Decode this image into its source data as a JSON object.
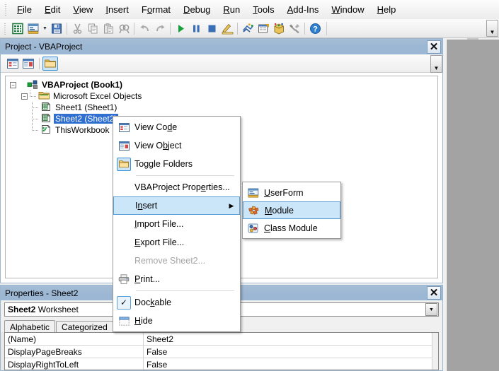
{
  "menubar": {
    "items": [
      {
        "label": "File",
        "accel": "F"
      },
      {
        "label": "Edit",
        "accel": "E"
      },
      {
        "label": "View",
        "accel": "V"
      },
      {
        "label": "Insert",
        "accel": "I"
      },
      {
        "label": "Format",
        "accel": "o"
      },
      {
        "label": "Debug",
        "accel": "D"
      },
      {
        "label": "Run",
        "accel": "R"
      },
      {
        "label": "Tools",
        "accel": "T"
      },
      {
        "label": "Add-Ins",
        "accel": "A"
      },
      {
        "label": "Window",
        "accel": "W"
      },
      {
        "label": "Help",
        "accel": "H"
      }
    ]
  },
  "toolbar": {
    "buttons": [
      {
        "name": "view-excel-icon",
        "title": "View Microsoft Excel"
      },
      {
        "name": "insert-userform-icon",
        "title": "Insert UserForm"
      },
      {
        "name": "save-icon",
        "title": "Save Book1"
      },
      {
        "name": "cut-icon",
        "title": "Cut"
      },
      {
        "name": "copy-icon",
        "title": "Copy"
      },
      {
        "name": "paste-icon",
        "title": "Paste"
      },
      {
        "name": "find-icon",
        "title": "Find"
      },
      {
        "name": "undo-icon",
        "title": "Undo"
      },
      {
        "name": "redo-icon",
        "title": "Redo"
      },
      {
        "name": "run-icon",
        "title": "Run Sub/UserForm"
      },
      {
        "name": "pause-icon",
        "title": "Break"
      },
      {
        "name": "stop-icon",
        "title": "Reset"
      },
      {
        "name": "design-mode-icon",
        "title": "Design Mode"
      },
      {
        "name": "project-explorer-icon",
        "title": "Project Explorer"
      },
      {
        "name": "properties-window-icon",
        "title": "Properties Window"
      },
      {
        "name": "object-browser-icon",
        "title": "Object Browser"
      },
      {
        "name": "toolbox-icon",
        "title": "Toolbox"
      },
      {
        "name": "help-icon",
        "title": "Microsoft Visual Basic for Applications Help"
      }
    ]
  },
  "project_panel": {
    "title": "Project - VBAProject",
    "close_label": "✕",
    "toolbar": [
      {
        "name": "view-code-icon",
        "title": "View Code"
      },
      {
        "name": "view-object-icon",
        "title": "View Object"
      },
      {
        "name": "toggle-folders-icon",
        "title": "Toggle Folders",
        "selected": true
      }
    ],
    "tree": [
      {
        "label": "VBAProject (Book1)",
        "level": 0,
        "bold": true,
        "selected": false,
        "icon": "vbaproject-icon",
        "expander": "-"
      },
      {
        "label": "Microsoft Excel Objects",
        "level": 1,
        "bold": false,
        "selected": false,
        "icon": "folder-icon",
        "expander": "-"
      },
      {
        "label": "Sheet1 (Sheet1)",
        "level": 2,
        "bold": false,
        "selected": false,
        "icon": "worksheet-icon",
        "expander": ""
      },
      {
        "label": "Sheet2 (Sheet2)",
        "level": 2,
        "bold": false,
        "selected": true,
        "icon": "worksheet-icon",
        "expander": ""
      },
      {
        "label": "ThisWorkbook",
        "level": 2,
        "bold": false,
        "selected": false,
        "icon": "workbook-icon",
        "expander": ""
      }
    ]
  },
  "context_menu": {
    "items": [
      {
        "label": "View Code",
        "accel": "d",
        "icon": "view-code-icon",
        "state": "normal",
        "submenu": false
      },
      {
        "label": "View Object",
        "accel": "b",
        "icon": "view-object-icon",
        "state": "normal",
        "submenu": false
      },
      {
        "label": "Toggle Folders",
        "accel": "",
        "icon": "toggle-folders-icon",
        "state": "normal",
        "submenu": false
      },
      {
        "separator": true
      },
      {
        "label": "VBAProject Properties...",
        "accel": "e",
        "icon": "",
        "state": "normal",
        "submenu": false
      },
      {
        "label": "Insert",
        "accel": "n",
        "icon": "",
        "state": "highlighted",
        "submenu": true,
        "arrow": "▶"
      },
      {
        "label": "Import File...",
        "accel": "I",
        "icon": "",
        "state": "normal",
        "submenu": false
      },
      {
        "label": "Export File...",
        "accel": "E",
        "icon": "",
        "state": "normal",
        "submenu": false
      },
      {
        "label": "Remove Sheet2...",
        "accel": "R",
        "icon": "",
        "state": "disabled",
        "submenu": false
      },
      {
        "label": "Print...",
        "accel": "P",
        "icon": "print-icon",
        "state": "normal",
        "submenu": false
      },
      {
        "separator": true
      },
      {
        "label": "Dockable",
        "accel": "k",
        "icon": "checkmark-icon",
        "state": "checked",
        "submenu": false
      },
      {
        "label": "Hide",
        "accel": "H",
        "icon": "hide-window-icon",
        "state": "normal",
        "submenu": false
      }
    ]
  },
  "insert_submenu": {
    "items": [
      {
        "label": "UserForm",
        "accel": "U",
        "icon": "userform-icon",
        "state": "normal"
      },
      {
        "label": "Module",
        "accel": "M",
        "icon": "module-icon",
        "state": "highlighted"
      },
      {
        "label": "Class Module",
        "accel": "C",
        "icon": "class-module-icon",
        "state": "normal"
      }
    ]
  },
  "properties_panel": {
    "title": "Properties - Sheet2",
    "close_label": "✕",
    "object_name": "Sheet2",
    "object_type": "Worksheet",
    "dropdown_arrow": "▼",
    "tabs": [
      {
        "label": "Alphabetic",
        "active": true
      },
      {
        "label": "Categorized",
        "active": false
      }
    ],
    "grid": [
      {
        "name": "(Name)",
        "value": "Sheet2"
      },
      {
        "name": "DisplayPageBreaks",
        "value": "False"
      },
      {
        "name": "DisplayRightToLeft",
        "value": "False"
      }
    ]
  },
  "colors": {
    "panel_title_bar": "#9cb7d3",
    "selection_blue": "#2f6fd0",
    "menu_highlight": "#cbe5f9",
    "menu_highlight_border": "#5b9fd4",
    "mdi_background": "#a3a3a3",
    "disabled_text": "#a5a5a5"
  }
}
